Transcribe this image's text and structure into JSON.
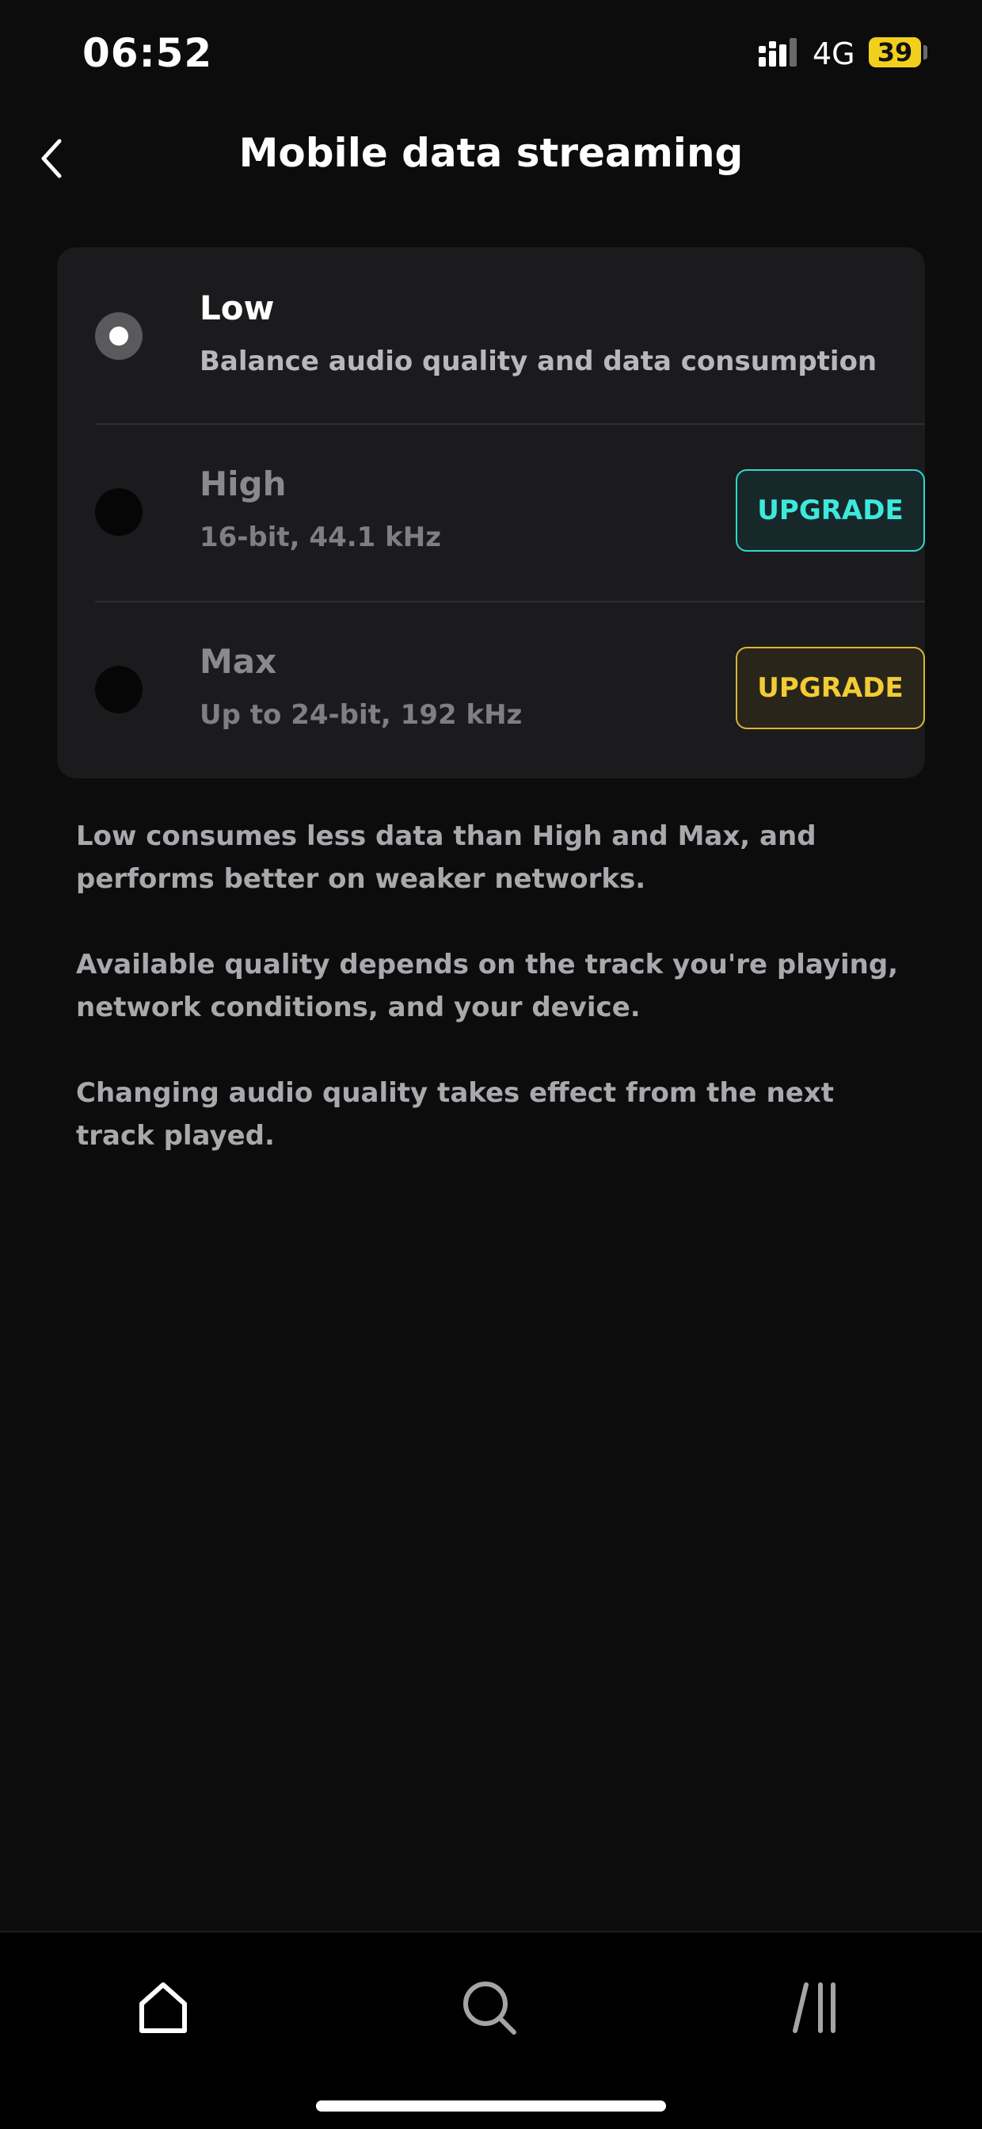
{
  "status_bar": {
    "time": "06:52",
    "network": "4G",
    "battery": "39",
    "icons": [
      "signal-icon",
      "battery-icon"
    ]
  },
  "header": {
    "title": "Mobile data streaming",
    "back_icon": "chevron-left-icon"
  },
  "options": [
    {
      "title": "Low",
      "subtitle": "Balance audio quality and data consumption",
      "selected": true
    },
    {
      "title": "High",
      "subtitle": "16-bit, 44.1 kHz",
      "selected": false,
      "action_label": "UPGRADE",
      "action_color": "#3ee8dc"
    },
    {
      "title": "Max",
      "subtitle": "Up to 24-bit, 192 kHz",
      "selected": false,
      "action_label": "UPGRADE",
      "action_color": "#f1cc34"
    }
  ],
  "info": {
    "p1": "Low consumes less data than High and Max, and performs better on weaker networks.",
    "p2": "Available quality depends on the track you're playing, network conditions, and your device.",
    "p3_line1": "Changing audio quality takes effect from the next",
    "p3_line2": "track played."
  },
  "bottom_nav": {
    "items": [
      "home-icon",
      "search-icon",
      "collection-icon"
    ]
  },
  "colors": {
    "background": "#0c0c0d",
    "card": "#1b1b1d",
    "accent_cyan": "#3ee8dc",
    "accent_gold": "#f1cc34",
    "battery": "#f2cf1c"
  }
}
